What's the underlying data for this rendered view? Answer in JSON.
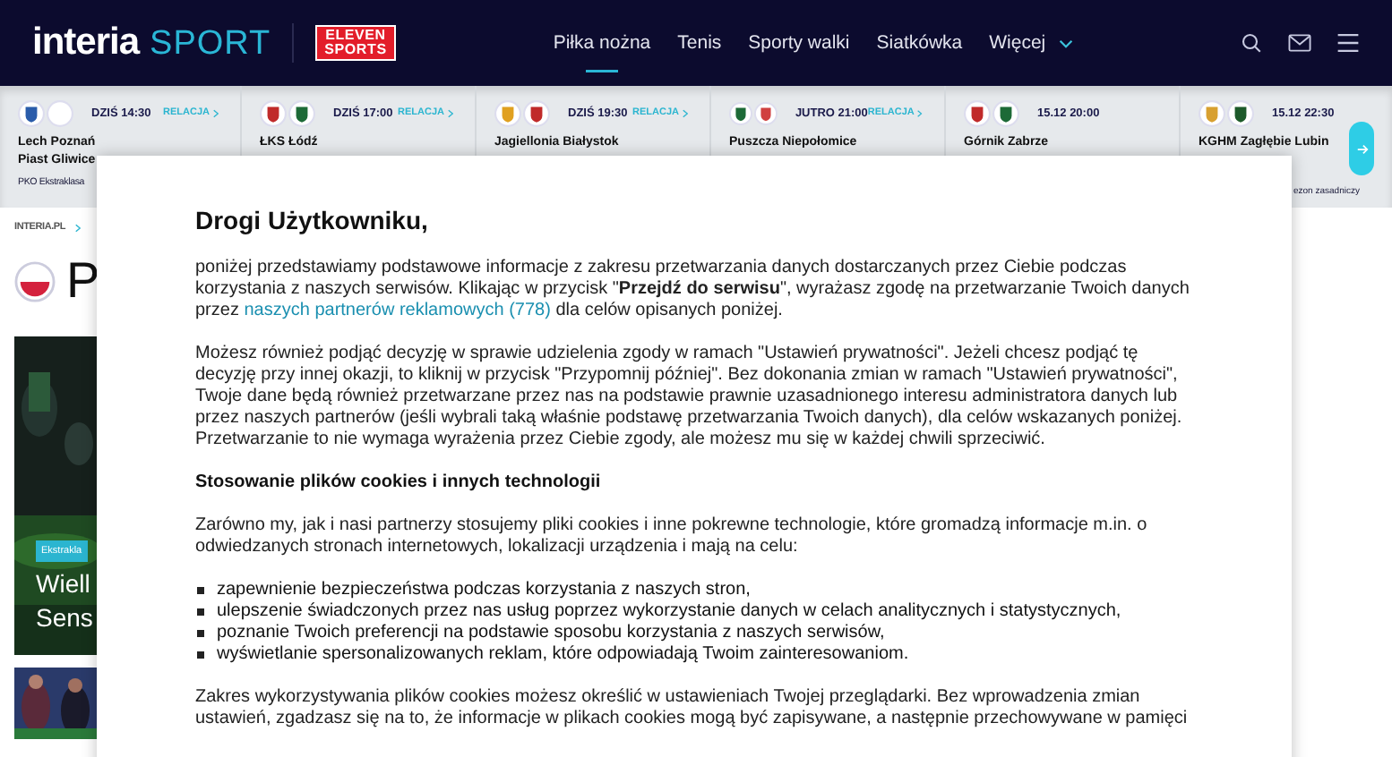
{
  "header": {
    "brand": "interia",
    "section": "SPORT",
    "partner_logo": [
      "ELEVEN",
      "SPORTS"
    ],
    "nav": [
      {
        "label": "Piłka nożna",
        "selected": true
      },
      {
        "label": "Tenis",
        "selected": false
      },
      {
        "label": "Sporty walki",
        "selected": false
      },
      {
        "label": "Siatkówka",
        "selected": false
      },
      {
        "label": "Więcej",
        "selected": false,
        "dropdown": true
      }
    ]
  },
  "matches": [
    {
      "time": "DZIŚ 14:30",
      "link": "RELACJA",
      "teams": [
        "Lech Poznań",
        "Piast Gliwice"
      ],
      "league": "PKO Ekstraklasa"
    },
    {
      "time": "DZIŚ 17:00",
      "link": "RELACJA",
      "teams": [
        "ŁKS Łódź"
      ]
    },
    {
      "time": "DZIŚ 19:30",
      "link": "RELACJA",
      "teams": [
        "Jagiellonia Białystok"
      ]
    },
    {
      "time": "JUTRO 21:00",
      "link": "RELACJA",
      "teams": [
        "Puszcza Niepołomice"
      ]
    },
    {
      "time": "15.12 20:00",
      "teams": [
        "Górnik Zabrze"
      ]
    },
    {
      "time": "15.12 22:30",
      "teams": [
        "KGHM Zagłębie Lubin"
      ]
    }
  ],
  "strip_trailing_text": "ezon zasadniczy",
  "page": {
    "breadcrumb": "INTERIA.PL",
    "title": "P",
    "article": {
      "kind": "picture",
      "tag": "Ekstrakla",
      "headline": [
        "Wiell",
        "Sens"
      ]
    }
  },
  "consent": {
    "title": "Drogi Użytkowniku,",
    "blocks": [
      {
        "kind": "intro",
        "before": "poniżej przedstawiamy podstawowe informacje z zakresu przetwarzania danych dostarczanych przez Ciebie podczas korzystania z naszych serwisów. Klikając w przycisk \"**Przejdź do serwisu**\", wyrażasz zgodę na przetwarzanie Twoich danych przez ",
        "link": "naszych partnerów reklamowych (778)",
        "after": " dla celów opisanych poniżej."
      },
      {
        "kind": "text",
        "text": "Możesz również podjąć decyzję w sprawie udzielenia zgody w ramach \"Ustawień prywatności\". Jeżeli chcesz podjąć tę decyzję przy innej okazji, to kliknij w przycisk \"Przypomnij później\". Bez dokonania zmian w ramach \"Ustawień prywatności\", Twoje dane będą również przetwarzane przez nas na podstawie prawnie uzasadnionego interesu administratora danych lub przez naszych partnerów (jeśli wybrali taką właśnie podstawę przetwarzania Twoich danych), dla celów wskazanych poniżej. Przetwarzanie to nie wymaga wyrażenia przez Ciebie zgody, ale możesz mu się w każdej chwili sprzeciwić."
      },
      {
        "kind": "heading",
        "text": "Stosowanie plików cookies i innych technologii"
      },
      {
        "kind": "text",
        "text": "Zarówno my, jak i  nasi partnerzy stosujemy pliki cookies i inne pokrewne technologie, które gromadzą informacje m.in. o odwiedzanych stronach internetowych, lokalizacji urządzenia i mają na celu:"
      },
      {
        "kind": "list",
        "items": [
          "zapewnienie bezpieczeństwa podczas korzystania z naszych stron,",
          "ulepszenie świadczonych przez nas usług poprzez wykorzystanie danych w celach analitycznych i statystycznych,",
          "poznanie Twoich preferencji na podstawie sposobu korzystania z naszych serwisów,",
          "wyświetlanie spersonalizowanych reklam, które odpowiadają Twoim zainteresowaniom."
        ]
      },
      {
        "kind": "text",
        "text": "Zakres wykorzystywania plików cookies możesz określić w ustawieniach Twojej przeglądarki. Bez wprowadzenia zmian ustawień, zgadzasz się na to, że informacje w plikach cookies mogą być zapisywane, a następnie przechowywane w pamięci"
      }
    ]
  }
}
